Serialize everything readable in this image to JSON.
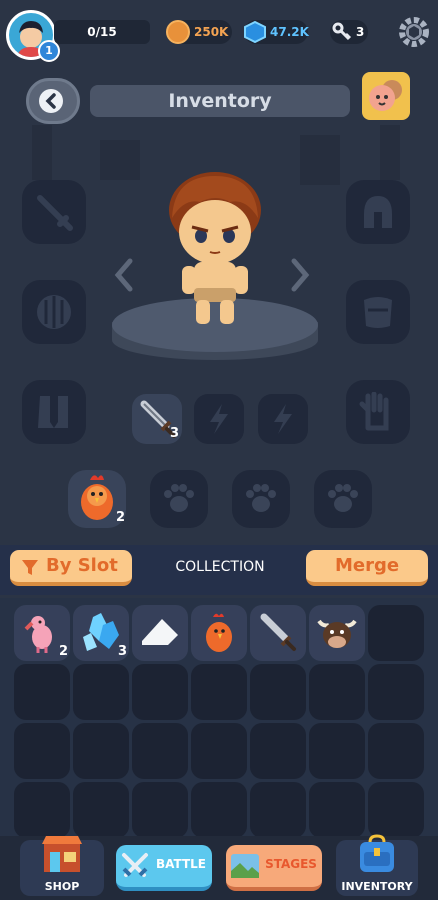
{
  "player": {
    "level": "1",
    "xp": "0/15"
  },
  "currency": {
    "coins": "250K",
    "gems": "47.2K",
    "keys": "3"
  },
  "header": {
    "title": "Inventory"
  },
  "equipped": {
    "weapon_count": "3",
    "pet_count": "2"
  },
  "toolbar": {
    "by_slot_label": "By Slot",
    "collection_label": "COLLECTION",
    "merge_label": "Merge"
  },
  "inventory": {
    "items": [
      {
        "name": "flamingo-pet",
        "count": "2"
      },
      {
        "name": "crystal-gems",
        "count": "3"
      },
      {
        "name": "white-arrow",
        "count": ""
      },
      {
        "name": "chicken-pet",
        "count": ""
      },
      {
        "name": "sword",
        "count": ""
      },
      {
        "name": "bull-pet",
        "count": ""
      }
    ]
  },
  "nav": {
    "shop": "SHOP",
    "battle": "BATTLE",
    "stages": "STAGES",
    "inventory": "INVENTORY"
  },
  "colors": {
    "background": "#2b3445",
    "accent_orange": "#fbc98a",
    "merge_text": "#e26b2b",
    "coin": "#e8913a",
    "gem": "#5fc3ff"
  }
}
